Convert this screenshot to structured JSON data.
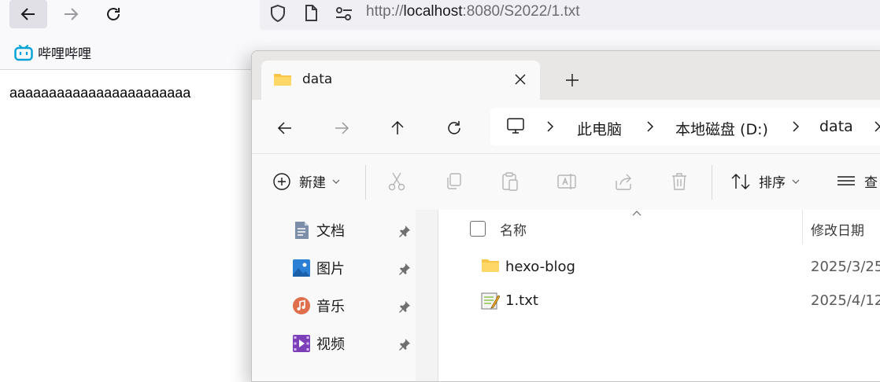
{
  "browser": {
    "url_prefix": "http://",
    "url_host": "localhost",
    "url_rest": ":8080/S2022/1.txt",
    "bookmark_label": "哔哩哔哩",
    "page_text": "aaaaaaaaaaaaaaaaaaaaaaa",
    "icons": [
      "back-arrow-icon",
      "forward-arrow-icon",
      "reload-icon",
      "shield-icon",
      "page-icon",
      "permissions-icon",
      "bilibili-icon"
    ]
  },
  "explorer": {
    "tab_title": "data",
    "breadcrumbs": [
      "此电脑",
      "本地磁盘 (D:)",
      "data"
    ],
    "commands": {
      "new_label": "新建",
      "sort_label": "排序",
      "view_label": "查"
    },
    "nav_items": [
      {
        "label": "文档",
        "icon": "documents-icon"
      },
      {
        "label": "图片",
        "icon": "pictures-icon"
      },
      {
        "label": "音乐",
        "icon": "music-icon"
      },
      {
        "label": "视频",
        "icon": "videos-icon"
      }
    ],
    "columns": {
      "name": "名称",
      "modified": "修改日期"
    },
    "files": [
      {
        "name": "hexo-blog",
        "date": "2025/3/25",
        "icon": "folder-icon"
      },
      {
        "name": "1.txt",
        "date": "2025/4/12",
        "icon": "text-file-icon"
      }
    ],
    "colors": {
      "folder": "#f8c548",
      "accent": "#0067c0"
    }
  }
}
